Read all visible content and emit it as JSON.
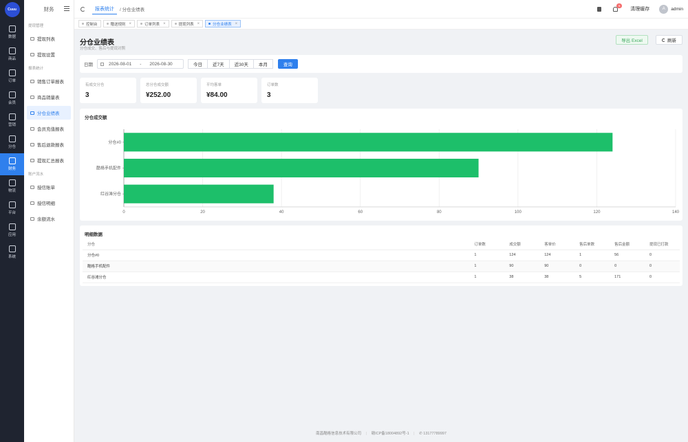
{
  "rail": {
    "logo": "Cuuu",
    "items": [
      {
        "label": "数据",
        "icon": "chart-icon"
      },
      {
        "label": "商品",
        "icon": "bag-icon"
      },
      {
        "label": "订单",
        "icon": "cart-icon"
      },
      {
        "label": "会员",
        "icon": "user-icon"
      },
      {
        "label": "营销",
        "icon": "marketing-icon"
      },
      {
        "label": "分仓",
        "icon": "building-icon"
      },
      {
        "label": "财务",
        "icon": "folder-icon"
      },
      {
        "label": "物流",
        "icon": "truck-icon"
      },
      {
        "label": "平台",
        "icon": "monitor-icon"
      },
      {
        "label": "应用",
        "icon": "grid-icon"
      },
      {
        "label": "系统",
        "icon": "gear-icon"
      }
    ],
    "active_index": 6
  },
  "submenu": {
    "title": "财务",
    "groups": [
      {
        "title": "提现管理",
        "items": [
          "提现列表",
          "提现设置"
        ]
      },
      {
        "title": "报表统计",
        "items": [
          "销售订单报表",
          "商品销量表",
          "分仓业绩表",
          "会员充值报表",
          "售后退款报表",
          "提现汇总报表"
        ]
      },
      {
        "title": "账户流水",
        "items": [
          "授信账单",
          "授信明细",
          "余额流水"
        ]
      }
    ],
    "active_item": "分仓业绩表"
  },
  "topbar": {
    "breadcrumb_active": "报表统计",
    "breadcrumb_current": "/ 分仓业绩表",
    "notification_count": "5",
    "clear_cache": "清理缓存",
    "avatar_letter": "A",
    "username": "admin"
  },
  "tabs": [
    {
      "label": "控制台",
      "closable": false,
      "active": false
    },
    {
      "label": "赠送规则",
      "closable": true,
      "active": false
    },
    {
      "label": "订单列表",
      "closable": true,
      "active": false
    },
    {
      "label": "提现列表",
      "closable": true,
      "active": false
    },
    {
      "label": "分仓业绩表",
      "closable": true,
      "active": true
    }
  ],
  "page": {
    "title": "分仓业绩表",
    "subtitle": "分仓成交、售后与提现对照",
    "export_label": "导出 Excel",
    "refresh_label": "刷新"
  },
  "filter": {
    "date_label": "日期",
    "start_date": "2026-08-01",
    "separator": "-",
    "end_date": "2026-08-30",
    "quick": [
      "今日",
      "近7天",
      "近30天",
      "本月"
    ],
    "query_label": "查询"
  },
  "stats": [
    {
      "label": "有成交分仓",
      "value": "3"
    },
    {
      "label": "总分仓成交额",
      "value": "¥252.00"
    },
    {
      "label": "平均客单",
      "value": "¥84.00"
    },
    {
      "label": "订单数",
      "value": "3"
    }
  ],
  "chart_data": {
    "type": "bar",
    "orientation": "horizontal",
    "title": "分仓成交额",
    "categories": [
      "分仓#0",
      "酷格手机配件",
      "红谷滩分仓"
    ],
    "values": [
      124,
      90,
      38
    ],
    "xlim": [
      0,
      140
    ],
    "xticks": [
      0,
      20,
      40,
      60,
      80,
      100,
      120,
      140
    ],
    "bar_color": "#1dbf6a",
    "grid": true
  },
  "table": {
    "title": "明细数据",
    "columns": [
      "分仓",
      "订单数",
      "成交额",
      "客单价",
      "售后单数",
      "售后金额",
      "提现已打款"
    ],
    "rows": [
      [
        "分仓#0",
        "1",
        "124",
        "124",
        "1",
        "56",
        "0"
      ],
      [
        "酷格手机配件",
        "1",
        "90",
        "90",
        "0",
        "0",
        "0"
      ],
      [
        "红谷滩分仓",
        "1",
        "38",
        "38",
        "5",
        "171",
        "0"
      ]
    ]
  },
  "footer": {
    "company": "南昌酷格信息技术有限公司",
    "icp": "赣ICP备18004892号-1",
    "phone": "13177789997"
  }
}
